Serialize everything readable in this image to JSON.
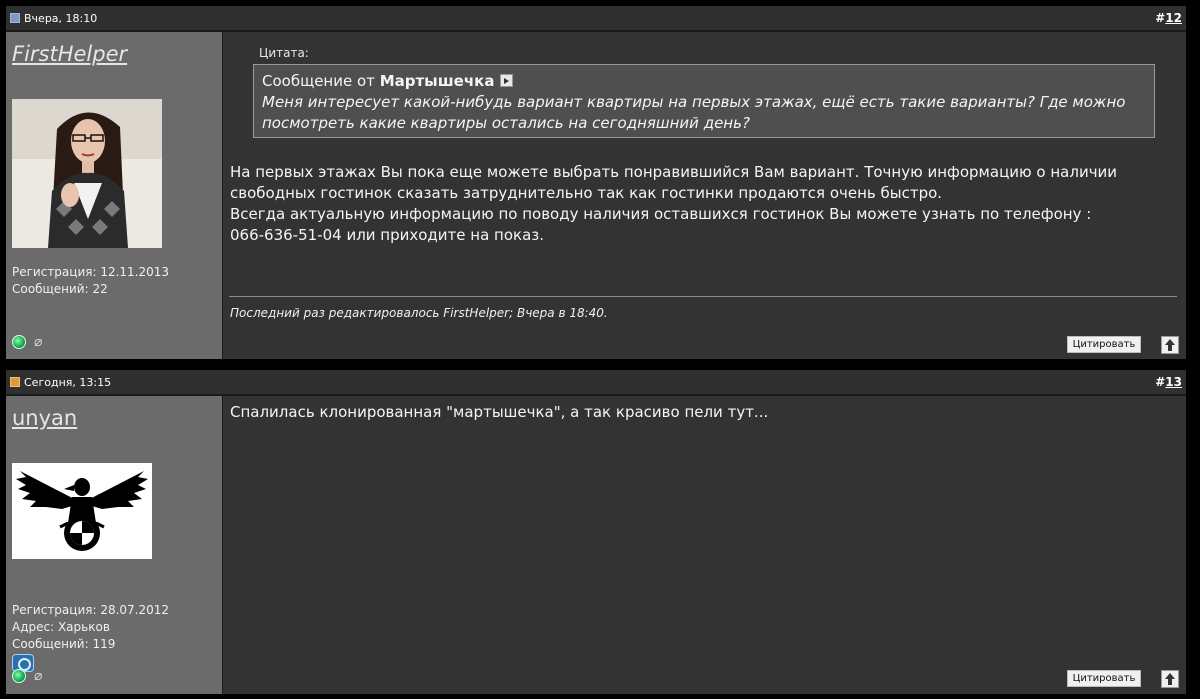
{
  "posts": [
    {
      "date": "Вчера, 18:10",
      "number_prefix": "#",
      "number": "12",
      "author": {
        "username": "FirstHelper",
        "registration": "Регистрация: 12.11.2013",
        "messages": "Сообщений: 22"
      },
      "quote": {
        "label": "Цитата:",
        "from_prefix": "Сообщение от",
        "from_author": "Мартышечка",
        "text": "Меня интересует какой-нибудь вариант квартиры на первых этажах, ещё есть такие варианты? Где можно посмотреть какие квартиры остались на сегодняшний день?"
      },
      "body": [
        "На первых этажах Вы пока еще можете выбрать понравившийся Вам вариант. Точную информацию о наличии свободных гостинок сказать затруднительно так как гостинки продаются очень быстро.",
        "Всегда актуальную информацию по поводу наличия оставшихся гостинок Вы можете узнать по телефону : 066-636-51-04 или приходите на показ."
      ],
      "edited_note": "Последний раз редактировалось FirstHelper; Вчера в 18:40.",
      "quote_button": "Цитировать",
      "icons": [
        "post-old-icon",
        "online-status-icon",
        "attachment-icon",
        "view-post-icon",
        "back-to-top-icon"
      ]
    },
    {
      "date": "Сегодня, 13:15",
      "number_prefix": "#",
      "number": "13",
      "author": {
        "username": "unyan",
        "registration": "Регистрация: 28.07.2012",
        "address": "Адрес: Харьков",
        "messages": "Сообщений: 119"
      },
      "body": [
        "Спалилась клонированная \"мартышечка\", а так красиво пели тут..."
      ],
      "quote_button": "Цитировать",
      "icons": [
        "post-new-icon",
        "award-icon",
        "online-status-icon",
        "attachment-icon",
        "back-to-top-icon"
      ]
    }
  ],
  "colors": {
    "page_background": "#000000",
    "header_background": "#303030",
    "sidebar_background": "#6b6b6b",
    "content_background": "#333333",
    "quote_background": "#4f4f4f"
  }
}
